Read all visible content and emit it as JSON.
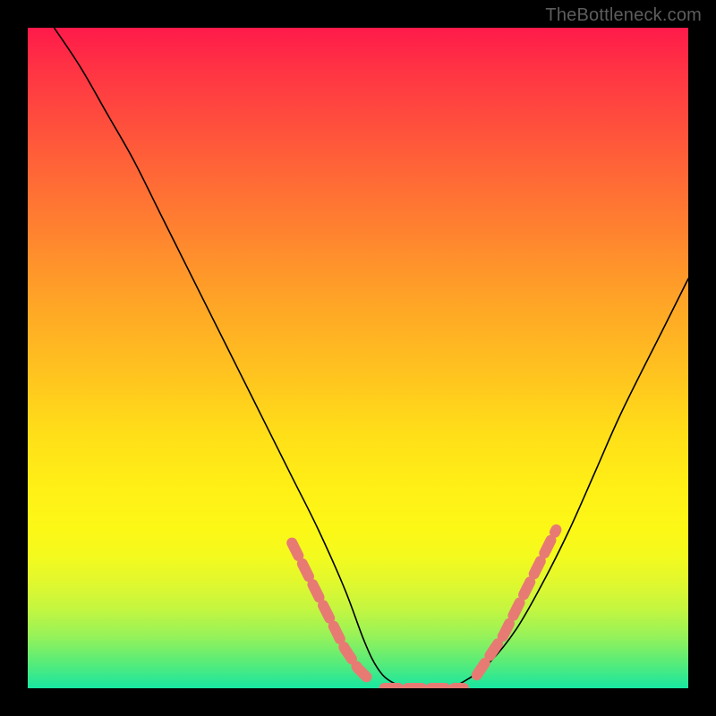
{
  "attribution": "TheBottleneck.com",
  "chart_data": {
    "type": "line",
    "title": "",
    "xlabel": "",
    "ylabel": "",
    "xlim": [
      0,
      100
    ],
    "ylim": [
      0,
      100
    ],
    "series": [
      {
        "name": "curve",
        "x": [
          4,
          8,
          12,
          16,
          20,
          24,
          28,
          32,
          36,
          40,
          44,
          48,
          51,
          53,
          55,
          58,
          60,
          63,
          66,
          70,
          74,
          78,
          82,
          86,
          90,
          96,
          100
        ],
        "y": [
          100,
          94,
          87,
          80,
          72,
          64,
          56,
          48,
          40,
          32,
          24,
          15,
          7,
          3,
          1,
          0,
          0,
          0,
          1,
          4,
          9,
          16,
          24,
          33,
          42,
          54,
          62
        ]
      }
    ],
    "highlight_segments": [
      {
        "x": [
          40,
          42,
          44,
          46,
          48,
          50,
          52
        ],
        "y": [
          22,
          18,
          14,
          10,
          6,
          3,
          1
        ]
      },
      {
        "x": [
          54,
          56,
          58,
          60,
          62,
          64,
          66
        ],
        "y": [
          0,
          0,
          0,
          0,
          0,
          0,
          0
        ]
      },
      {
        "x": [
          68,
          70,
          72,
          74,
          76,
          78,
          80
        ],
        "y": [
          2,
          5,
          8,
          12,
          16,
          20,
          24
        ]
      }
    ],
    "gradient_stops": [
      {
        "offset": 0,
        "color": "#ff1a4a"
      },
      {
        "offset": 50,
        "color": "#ffd020"
      },
      {
        "offset": 80,
        "color": "#f4fa1e"
      },
      {
        "offset": 100,
        "color": "#18e6a0"
      }
    ]
  }
}
